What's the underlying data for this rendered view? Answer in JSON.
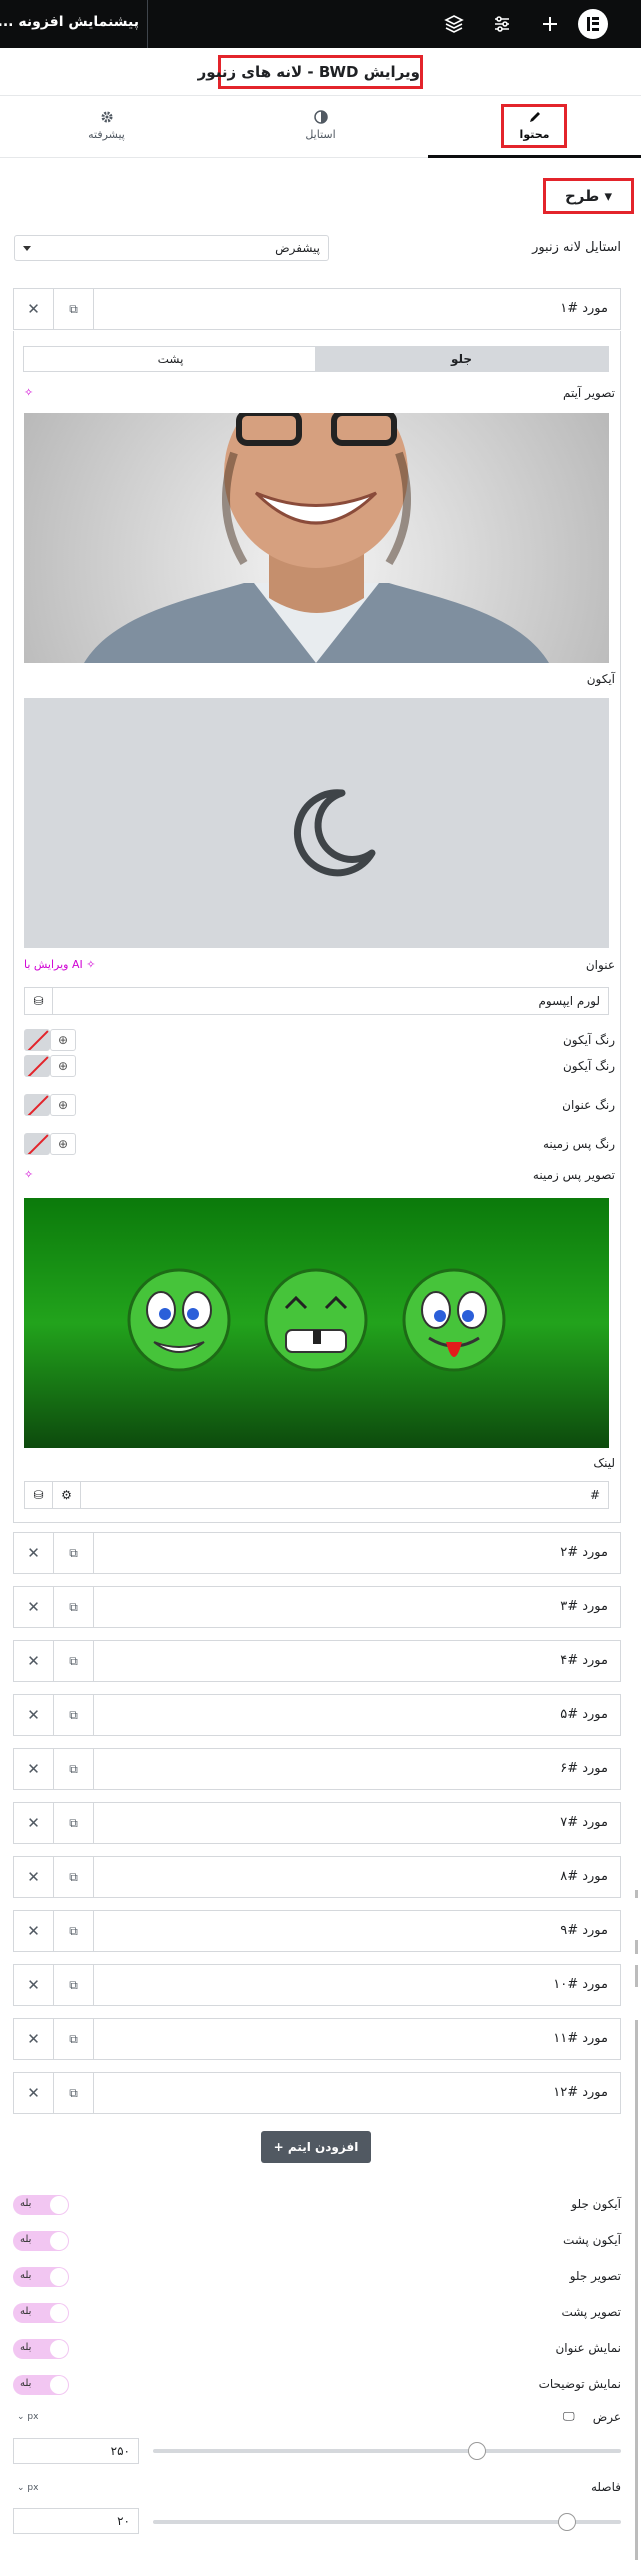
{
  "topbar": {
    "title": "پیشنمایش افزونه ..."
  },
  "header": {
    "title": "ویرایش BWD - لانه های زنبور"
  },
  "tabs": [
    {
      "label": "محتوا",
      "icon": "pencil-icon"
    },
    {
      "label": "استایل",
      "icon": "contrast-icon"
    },
    {
      "label": "پیشرفته",
      "icon": "gear-icon"
    }
  ],
  "section": {
    "label": "طرح"
  },
  "style_row": {
    "label": "استایل لانه زنبور",
    "value": "پیشفرض"
  },
  "items": [
    "مورد #۱",
    "مورد #۲",
    "مورد #۳",
    "مورد #۴",
    "مورد #۵",
    "مورد #۶",
    "مورد #۷",
    "مورد #۸",
    "مورد #۹",
    "مورد #۱۰",
    "مورد #۱۱",
    "مورد #۱۲"
  ],
  "item1": {
    "toggle_front": "جلو",
    "toggle_back": "پشت",
    "item_image_label": "تصویر آیتم",
    "icon_label": "آیکون",
    "title_label": "عنوان",
    "ai_edit": "ویرایش با AI",
    "title_value": "لورم ایپسوم",
    "icon_color1": "رنگ آیکون",
    "icon_color2": "رنگ آیکون",
    "title_color": "رنگ عنوان",
    "bg_color": "رنگ پس زمینه",
    "bg_image": "تصویر پس زمینه",
    "link_label": "لینک",
    "link_value": "#"
  },
  "add_item": "افزودن ایتم",
  "options": [
    {
      "label": "آیکون جلو",
      "value": "بله"
    },
    {
      "label": "آیکون پشت",
      "value": "بله"
    },
    {
      "label": "تصویر جلو",
      "value": "بله"
    },
    {
      "label": "تصویر پشت",
      "value": "بله"
    },
    {
      "label": "نمایش عنوان",
      "value": "بله"
    },
    {
      "label": "نمایش توضیحات",
      "value": "بله"
    }
  ],
  "width": {
    "label": "عرض",
    "unit": "px",
    "value": "۲۵۰",
    "level": 0.3
  },
  "gap": {
    "label": "فاصله",
    "unit": "px",
    "value": "۲۰",
    "level": 0.1
  },
  "colors": {
    "highlight": "#e3242b",
    "ai": "#d004d4",
    "toggle_on": "#f2c6f2"
  }
}
